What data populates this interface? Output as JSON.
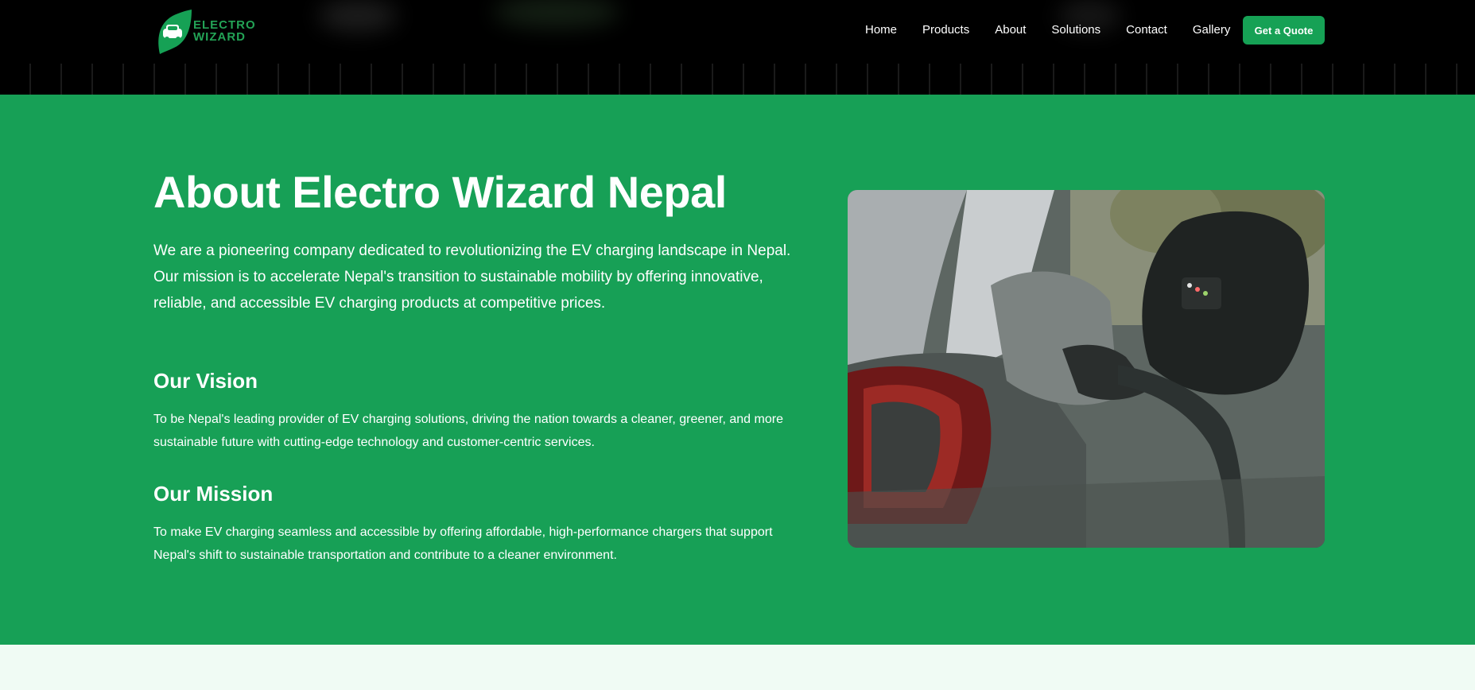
{
  "brand": {
    "logo_line1": "ELECTRO",
    "logo_line2": "WIZARD",
    "accent_color": "#16a155"
  },
  "nav": {
    "items": [
      "Home",
      "Products",
      "About",
      "Solutions",
      "Contact",
      "Gallery"
    ],
    "cta_label": "Get a Quote"
  },
  "about": {
    "title": "About Electro Wizard Nepal",
    "intro": "We are a pioneering company dedicated to revolutionizing the EV charging landscape in Nepal. Our mission is to accelerate Nepal's transition to sustainable mobility by offering innovative, reliable, and accessible EV charging products at competitive prices.",
    "vision_title": "Our Vision",
    "vision_text": "To be Nepal's leading provider of EV charging solutions, driving the nation towards a cleaner, greener, and more sustainable future with cutting-edge technology and customer-centric services.",
    "mission_title": "Our Mission",
    "mission_text": "To make EV charging seamless and accessible by offering affordable, high-performance chargers that support Nepal's shift to sustainable transportation and contribute to a cleaner environment."
  },
  "colors": {
    "header_bg": "#000000",
    "section_bg": "#17a056",
    "page_bg": "#f0fbf4"
  }
}
